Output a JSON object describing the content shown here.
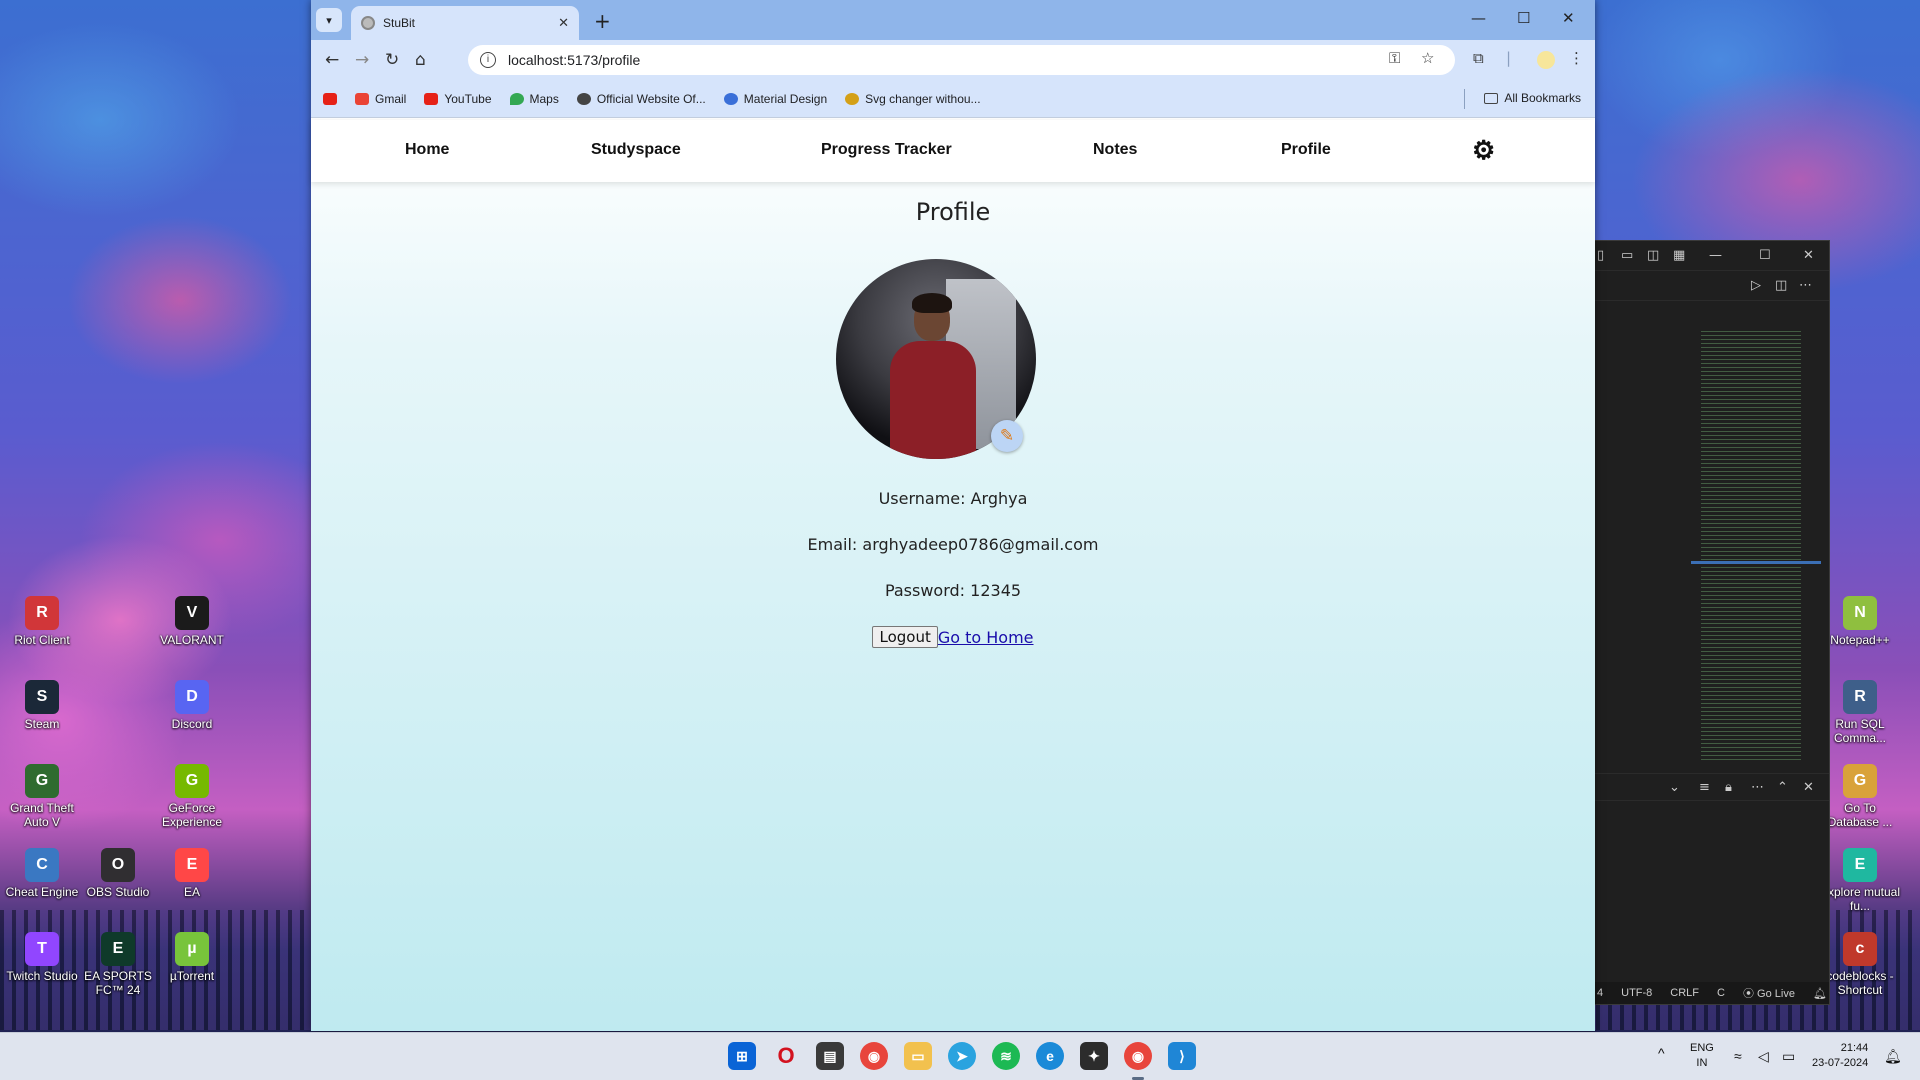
{
  "desktop": {
    "left_icons": [
      {
        "label": "Riot Client",
        "icon": "riot-client-icon",
        "color": "#d13639"
      },
      {
        "label": "VALORANT",
        "icon": "valorant-icon",
        "color": "#1b1b1b"
      },
      {
        "label": "Steam",
        "icon": "steam-icon",
        "color": "#1b2838"
      },
      {
        "label": "Discord",
        "icon": "discord-icon",
        "color": "#5865f2"
      },
      {
        "label": "Grand Theft Auto V",
        "icon": "gta-icon",
        "color": "#2f6b2f"
      },
      {
        "label": "GeForce Experience",
        "icon": "geforce-icon",
        "color": "#76b900"
      },
      {
        "label": "Cheat Engine",
        "icon": "cheat-engine-icon",
        "color": "#3a78c2"
      },
      {
        "label": "OBS Studio",
        "icon": "obs-icon",
        "color": "#302e31"
      },
      {
        "label": "EA",
        "icon": "ea-icon",
        "color": "#ff4747"
      },
      {
        "label": "Twitch Studio",
        "icon": "twitch-icon",
        "color": "#9146ff"
      },
      {
        "label": "EA SPORTS FC™ 24",
        "icon": "ea-sports-fc-icon",
        "color": "#0f3a2a"
      },
      {
        "label": "µTorrent",
        "icon": "utorrent-icon",
        "color": "#78c43b"
      }
    ],
    "right_icons": [
      {
        "label": "Notepad++",
        "icon": "notepad-plus-plus-icon",
        "color": "#8fbf3f"
      },
      {
        "label": "Run SQL Comma...",
        "icon": "run-sql-icon",
        "color": "#3e5f8a"
      },
      {
        "label": "Go To Database ...",
        "icon": "database-icon",
        "color": "#d9a23a"
      },
      {
        "label": "Explore mutual fu...",
        "icon": "explore-icon",
        "color": "#1fb8a0"
      },
      {
        "label": "codeblocks - Shortcut",
        "icon": "codeblocks-icon",
        "color": "#c0392b"
      }
    ]
  },
  "vscode": {
    "status": [
      "4",
      "UTF-8",
      "CRLF",
      "C",
      "Go Live"
    ]
  },
  "browser": {
    "tab_title": "StuBit",
    "url": "localhost:5173/profile",
    "bookmarks": [
      {
        "label": "",
        "color": "#e62117"
      },
      {
        "label": "Gmail",
        "color": "#ea4335"
      },
      {
        "label": "YouTube",
        "color": "#e62117"
      },
      {
        "label": "Maps",
        "color": "#34a853"
      },
      {
        "label": "Official Website Of...",
        "color": "#444444"
      },
      {
        "label": "Material Design",
        "color": "#3a6fd8"
      },
      {
        "label": "Svg changer withou...",
        "color": "#d4a017"
      }
    ],
    "all_bookmarks": "All Bookmarks"
  },
  "app": {
    "nav": {
      "home": "Home",
      "studyspace": "Studyspace",
      "progress": "Progress Tracker",
      "notes": "Notes",
      "profile": "Profile"
    },
    "page_title": "Profile",
    "username_line": "Username: Arghya",
    "email_line": "Email: arghyadeep0786@gmail.com",
    "password_line": "Password: 12345",
    "logout": "Logout",
    "go_home": "Go to Home"
  },
  "taskbar": {
    "lang": "ENG",
    "region": "IN",
    "time": "21:44",
    "date": "23-07-2024"
  }
}
